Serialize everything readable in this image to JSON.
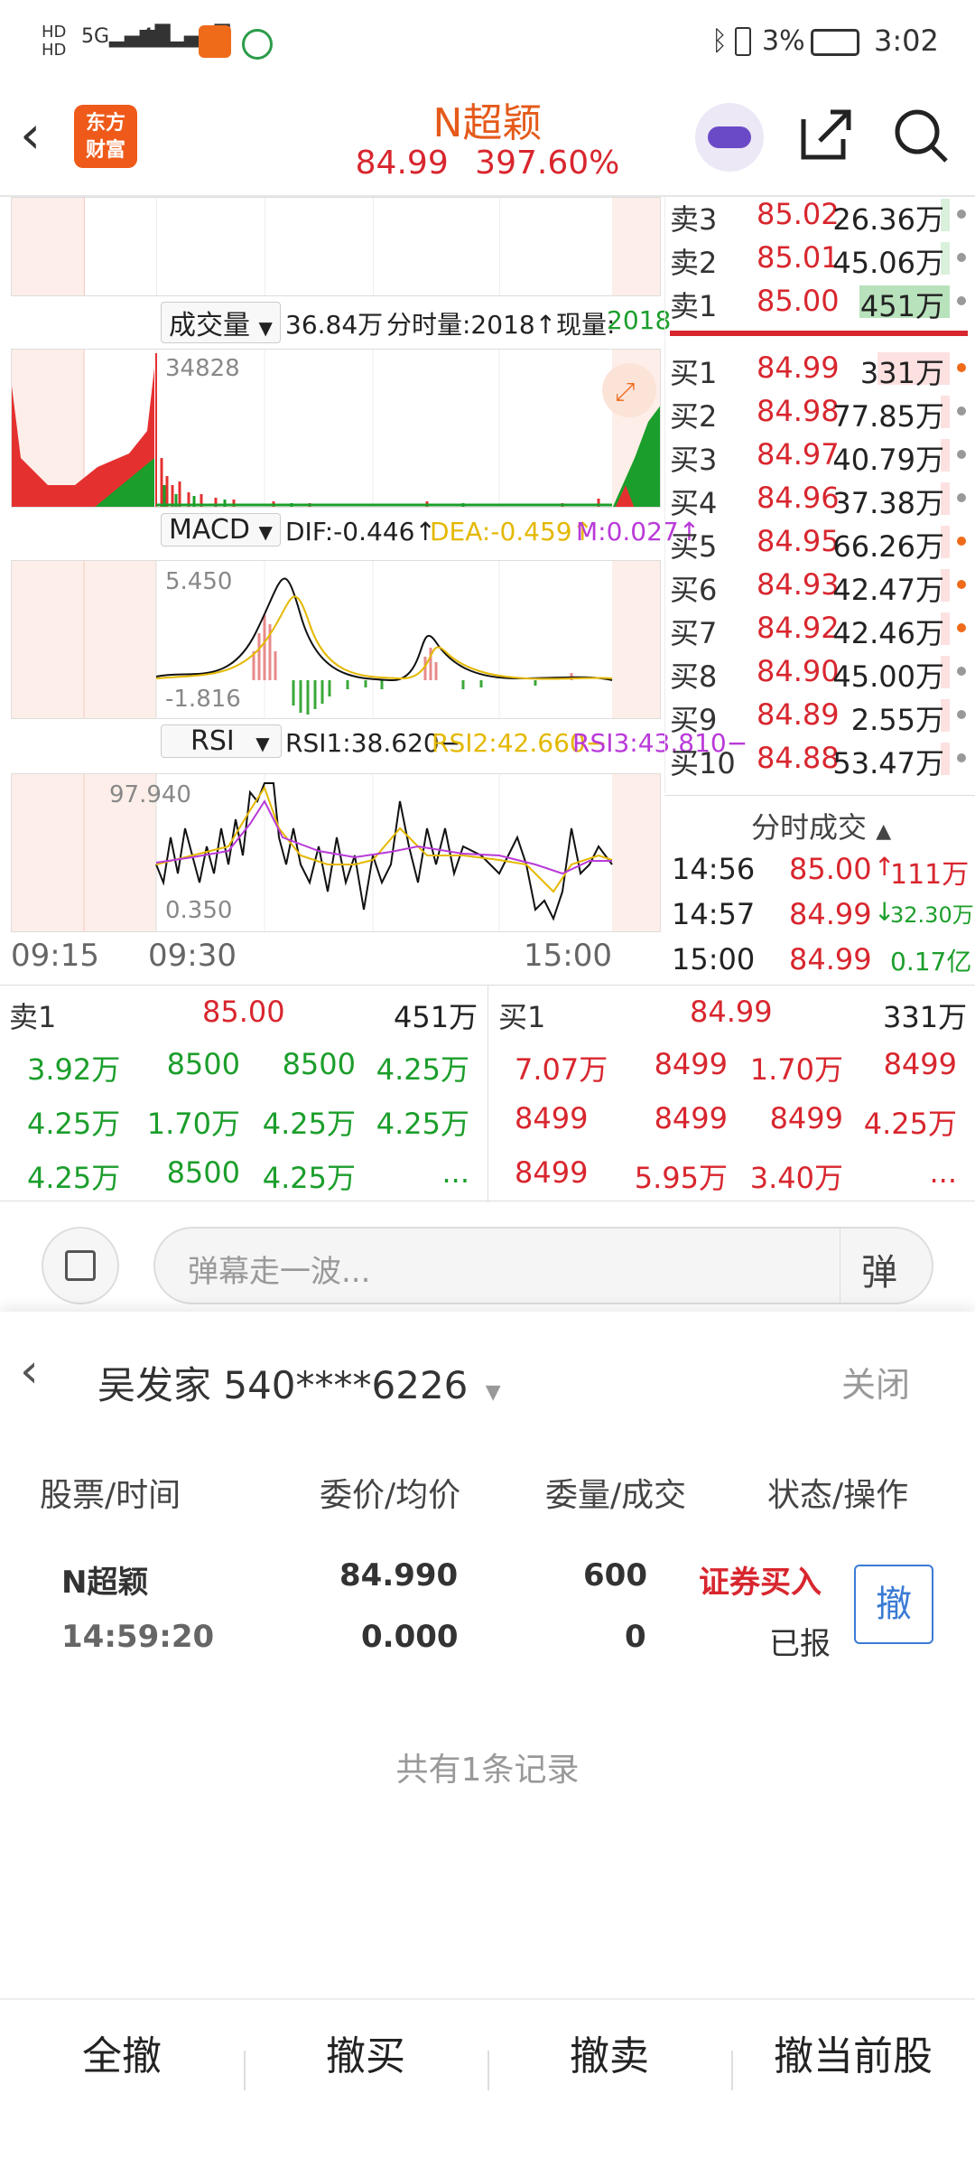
{
  "statusbar": {
    "network_left": "HD 5G 4G",
    "battery": "3%",
    "time": "3:02"
  },
  "header": {
    "logo_line1": "东方",
    "logo_line2": "财富",
    "stock_name": "N超颖",
    "price": "84.99",
    "change_pct": "397.60%"
  },
  "volume_panel": {
    "selector": "成交量",
    "total": "36.84万",
    "tick_vol_label": "分时量:2018↑",
    "now_label": "现量:",
    "now_value": "2018",
    "max_label": "34828"
  },
  "macd_panel": {
    "selector": "MACD",
    "dif": "DIF:-0.446↑",
    "dea": "DEA:-0.459↑",
    "m": "M:0.027↑",
    "max_label": "5.450",
    "min_label": "-1.816"
  },
  "rsi_panel": {
    "selector": "RSI",
    "rsi1": "RSI1:38.620−",
    "rsi2": "RSI2:42.660−",
    "rsi3": "RSI3:43.810−",
    "max_label": "97.940",
    "min_label": "0.350"
  },
  "time_axis": [
    "09:15",
    "09:30",
    "15:00"
  ],
  "order_book": {
    "asks": [
      {
        "label": "卖3",
        "price": "85.02",
        "vol": "26.36万"
      },
      {
        "label": "卖2",
        "price": "85.01",
        "vol": "45.06万"
      },
      {
        "label": "卖1",
        "price": "85.00",
        "vol": "451万"
      }
    ],
    "bids": [
      {
        "label": "买1",
        "price": "84.99",
        "vol": "331万"
      },
      {
        "label": "买2",
        "price": "84.98",
        "vol": "77.85万"
      },
      {
        "label": "买3",
        "price": "84.97",
        "vol": "40.79万"
      },
      {
        "label": "买4",
        "price": "84.96",
        "vol": "37.38万"
      },
      {
        "label": "买5",
        "price": "84.95",
        "vol": "66.26万"
      },
      {
        "label": "买6",
        "price": "84.93",
        "vol": "42.47万"
      },
      {
        "label": "买7",
        "price": "84.92",
        "vol": "42.46万"
      },
      {
        "label": "买8",
        "price": "84.90",
        "vol": "45.00万"
      },
      {
        "label": "买9",
        "price": "84.89",
        "vol": "2.55万"
      },
      {
        "label": "买10",
        "price": "84.88",
        "vol": "53.47万"
      }
    ]
  },
  "ticks": {
    "title": "分时成交",
    "rows": [
      {
        "time": "14:56",
        "price": "85.00",
        "arrow": "↑",
        "vol": "111万"
      },
      {
        "time": "14:57",
        "price": "84.99",
        "arrow": "↓",
        "vol": "32.30万"
      },
      {
        "time": "15:00",
        "price": "84.99",
        "arrow": "",
        "vol": "0.17亿"
      }
    ]
  },
  "queues": {
    "sell": {
      "label": "卖1",
      "price": "85.00",
      "vol": "451万",
      "items": [
        "3.92万",
        "8500",
        "8500",
        "4.25万",
        "4.25万",
        "1.70万",
        "4.25万",
        "4.25万",
        "4.25万",
        "8500",
        "4.25万",
        "..."
      ]
    },
    "buy": {
      "label": "买1",
      "price": "84.99",
      "vol": "331万",
      "items": [
        "7.07万",
        "8499",
        "1.70万",
        "8499",
        "8499",
        "8499",
        "8499",
        "4.25万",
        "8499",
        "5.95万",
        "3.40万",
        "..."
      ]
    }
  },
  "comment": {
    "placeholder": "弹幕走一波...",
    "danmu_btn": "弹"
  },
  "trade": {
    "account": "吴发家 540****6226",
    "close": "关闭",
    "headers": [
      "股票/时间",
      "委价/均价",
      "委量/成交",
      "状态/操作"
    ],
    "order": {
      "stock": "N超颖",
      "time": "14:59:20",
      "price": "84.990",
      "avg": "0.000",
      "qty": "600",
      "filled": "0",
      "status": "证券买入",
      "state": "已报",
      "cancel": "撤"
    },
    "records": "共有1条记录"
  },
  "bottom": [
    "全撤",
    "撤买",
    "撤卖",
    "撤当前股"
  ]
}
